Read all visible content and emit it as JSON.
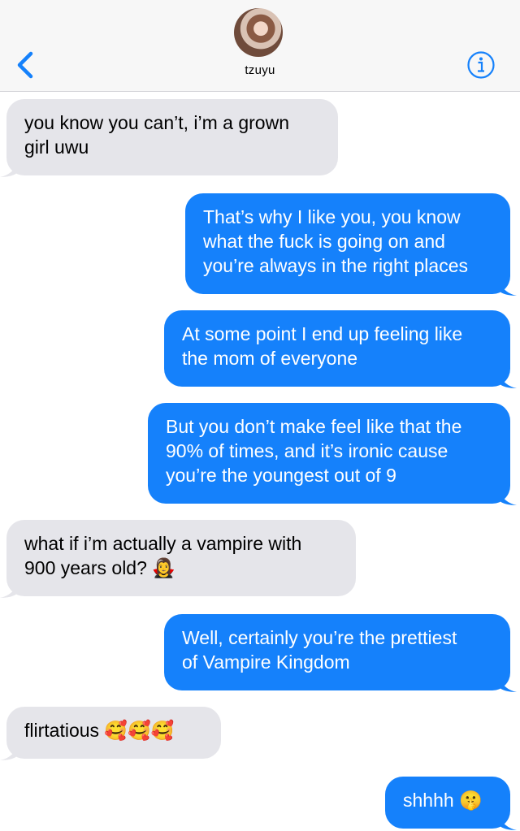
{
  "header": {
    "contact_name": "tzuyu",
    "back_icon": "chevron-left-icon",
    "info_icon": "info-icon",
    "accent_color": "#1581fb"
  },
  "messages": [
    {
      "from": "them",
      "lines": [
        "you know you can’t, i’m a grown",
        "girl uwu"
      ]
    },
    {
      "from": "me",
      "lines": [
        "That’s why I like you, you know",
        "what the fuck is going on and",
        "you’re always in the right places"
      ]
    },
    {
      "from": "me",
      "lines": [
        "At some point I end up feeling like",
        "the mom of everyone"
      ]
    },
    {
      "from": "me",
      "lines": [
        "But you don’t make feel like that the",
        "90% of times, and it’s ironic cause",
        "you’re the youngest out of 9"
      ]
    },
    {
      "from": "them",
      "lines": [
        "what if i’m actually a vampire with",
        "900 years old? 🧛‍♀️"
      ]
    },
    {
      "from": "me",
      "lines": [
        "Well, certainly you’re the prettiest",
        "of Vampire Kingdom"
      ]
    },
    {
      "from": "them",
      "lines": [
        "flirtatious 🥰🥰🥰"
      ]
    },
    {
      "from": "me",
      "lines": [
        "shhhh 🤫"
      ]
    }
  ]
}
